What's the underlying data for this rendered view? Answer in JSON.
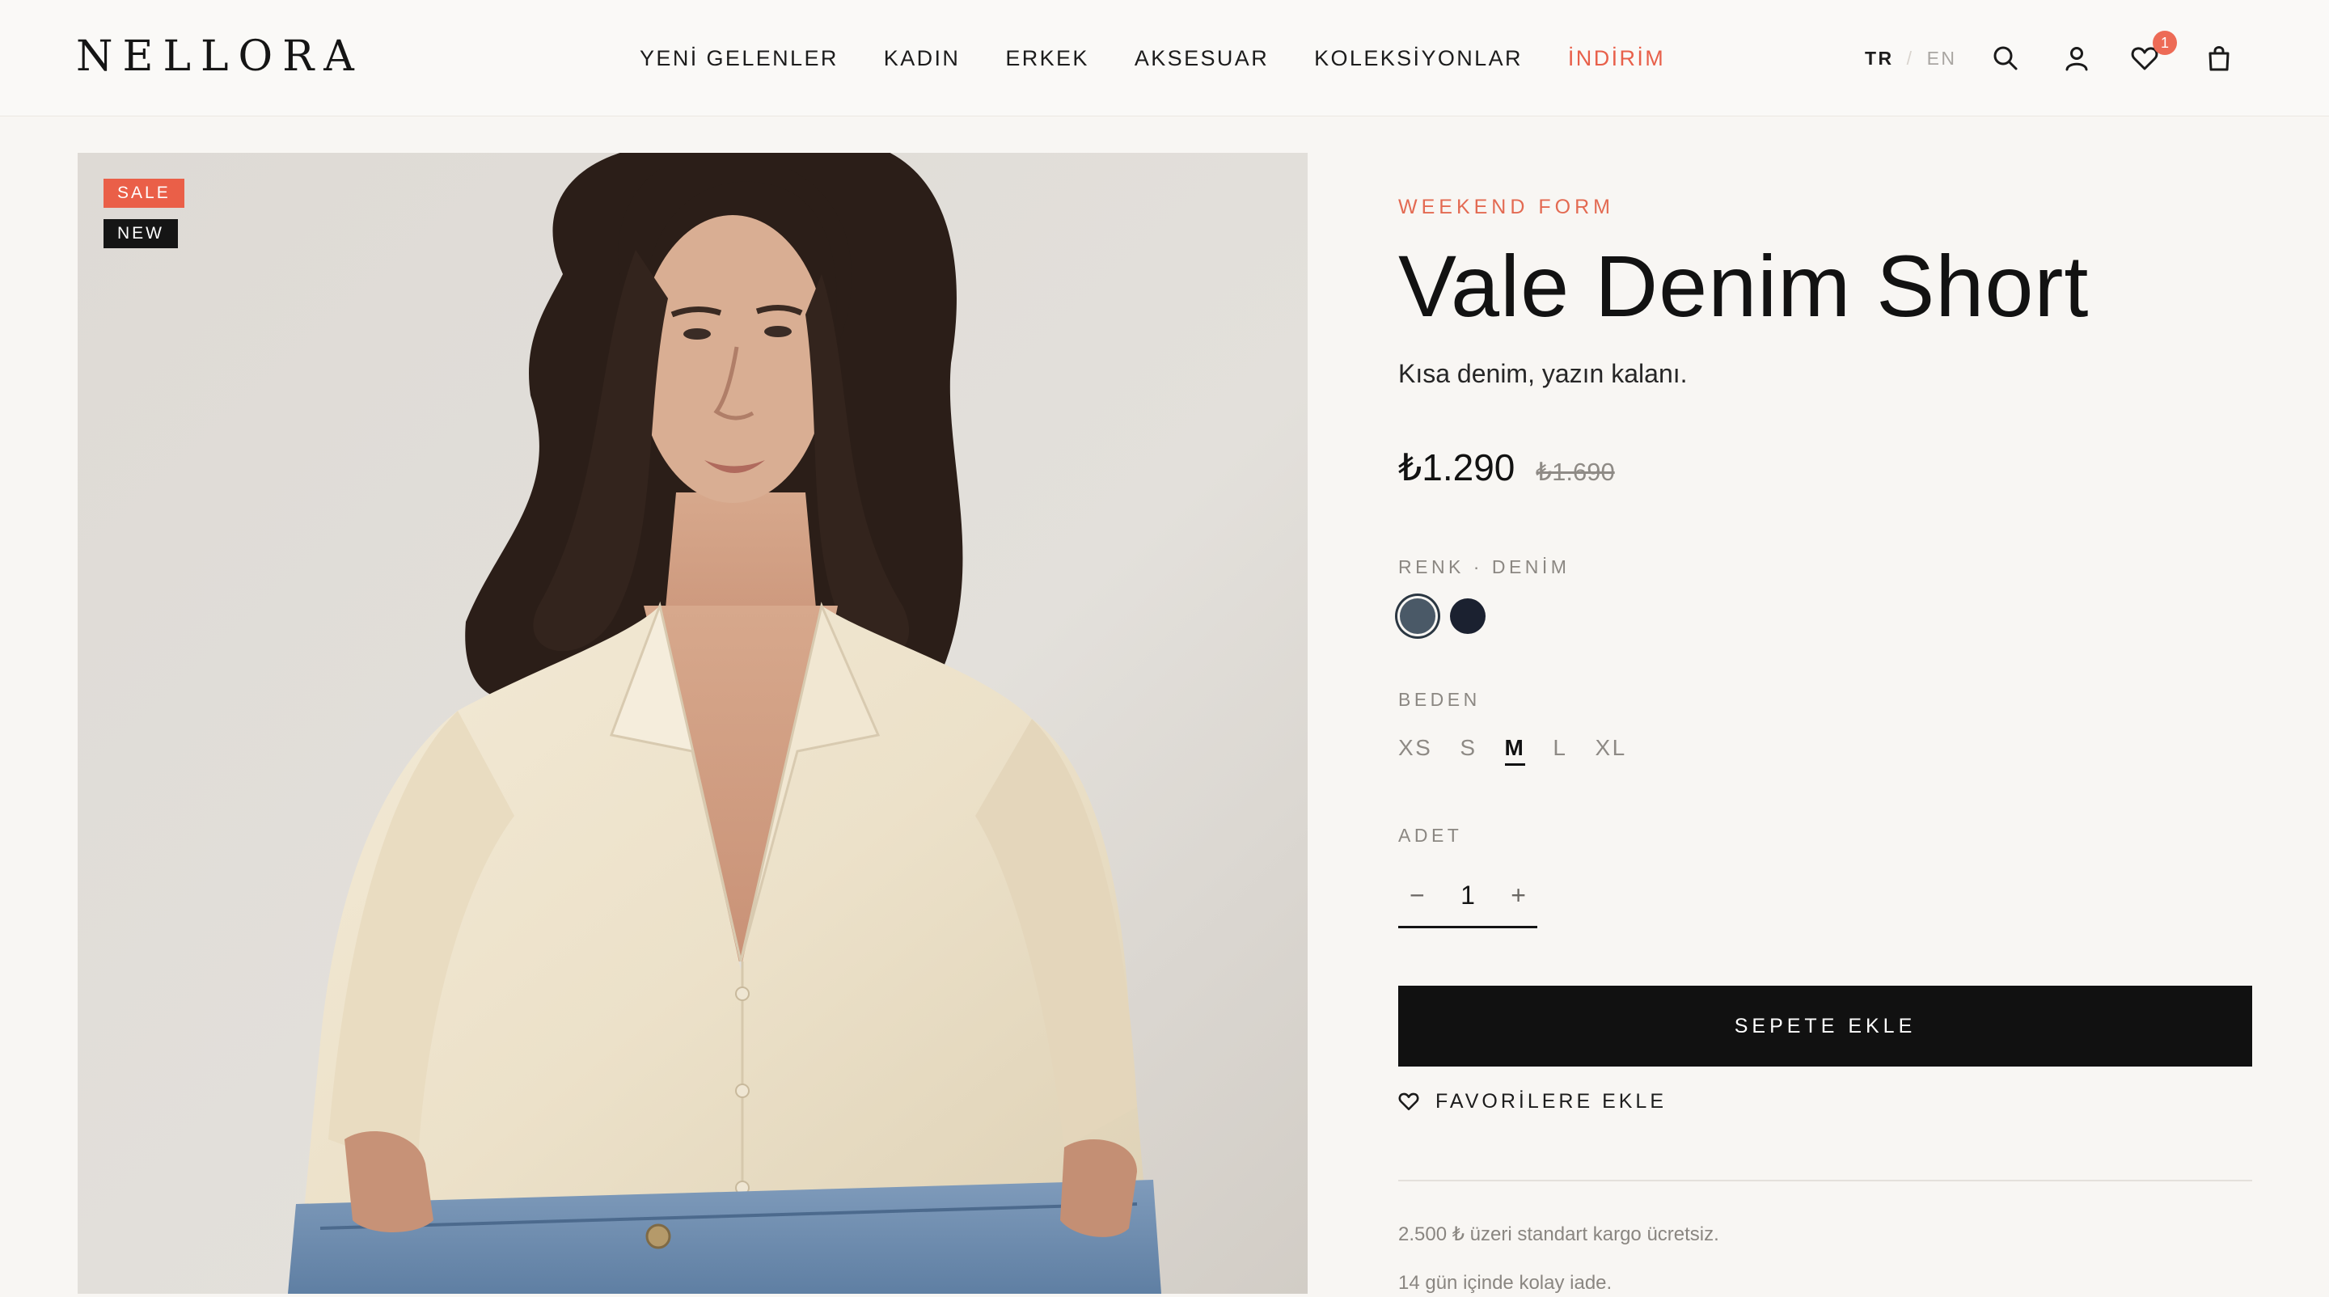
{
  "brand": {
    "logo_text": "NELLORA"
  },
  "nav": {
    "items": [
      {
        "label": "YENİ GELENLER"
      },
      {
        "label": "KADIN"
      },
      {
        "label": "ERKEK"
      },
      {
        "label": "AKSESUAR"
      },
      {
        "label": "KOLEKSİYONLAR"
      },
      {
        "label": "İNDİRİM"
      }
    ]
  },
  "language": {
    "active": "TR",
    "separator": "/",
    "inactive": "EN"
  },
  "header_icons": {
    "search": "search-icon",
    "account": "user-icon",
    "wishlist": "heart-icon",
    "cart": "bag-icon",
    "wishlist_count": "1"
  },
  "gallery": {
    "badges": {
      "sale": "SALE",
      "new": "NEW"
    },
    "image_subject": "product-photo"
  },
  "product": {
    "collection": "WEEKEND FORM",
    "name": "Vale Denim Short",
    "description": "Kısa denim, yazın kalanı.",
    "price": "₺1.290",
    "old_price": "₺1.690",
    "color_label": "RENK · DENİM",
    "colors": [
      {
        "name": "Denim",
        "hex": "#4a5967",
        "selected": true
      },
      {
        "name": "Lacivert",
        "hex": "#1b2130",
        "selected": false
      }
    ],
    "size_label": "BEDEN",
    "sizes": [
      "XS",
      "S",
      "M",
      "L",
      "XL"
    ],
    "selected_size": "M",
    "quantity_label": "ADET",
    "quantity": "1",
    "minus": "−",
    "plus": "+",
    "add_to_cart": "SEPETE EKLE",
    "add_to_favorites": "FAVORİLERE EKLE",
    "notes": [
      "2.500 ₺ üzeri standart kargo ücretsiz.",
      "14 gün içinde kolay iade."
    ]
  },
  "colors": {
    "background": "#f8f6f3",
    "accent": "#e8604a",
    "button": "#111111"
  }
}
